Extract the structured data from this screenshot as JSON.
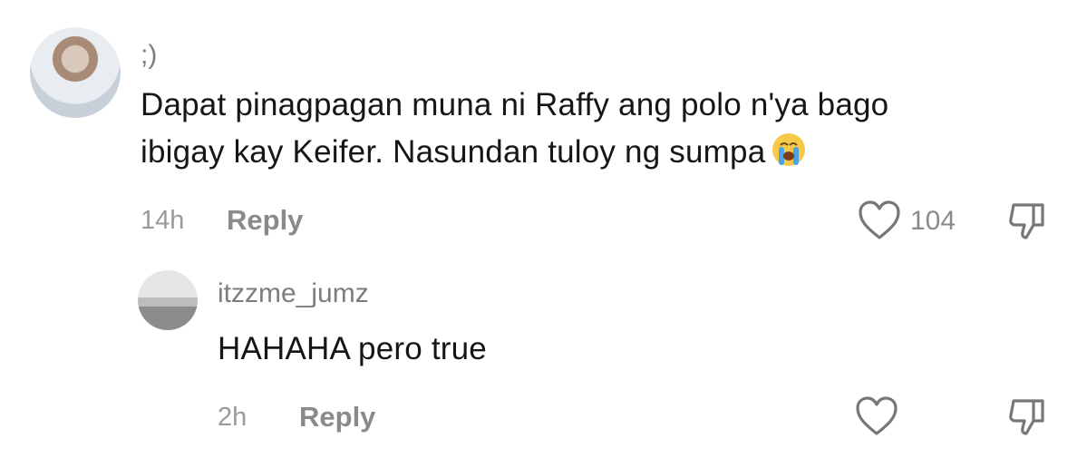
{
  "comments": [
    {
      "username": ";)",
      "text_line1": "Dapat pinagpagan muna ni Raffy ang polo n'ya bago",
      "text_line2": "ibigay kay Keifer. Nasundan tuloy ng sumpa",
      "emoji": "crying-face",
      "time": "14h",
      "reply_label": "Reply",
      "like_count": "104"
    },
    {
      "username": "itzzme_jumz",
      "text": "HAHAHA pero true",
      "time": "2h",
      "reply_label": "Reply",
      "like_count": ""
    }
  ],
  "colors": {
    "text": "#161616",
    "muted": "#8a8a8a",
    "emoji_face": "#f7c948",
    "tears": "#4aa3e6"
  }
}
